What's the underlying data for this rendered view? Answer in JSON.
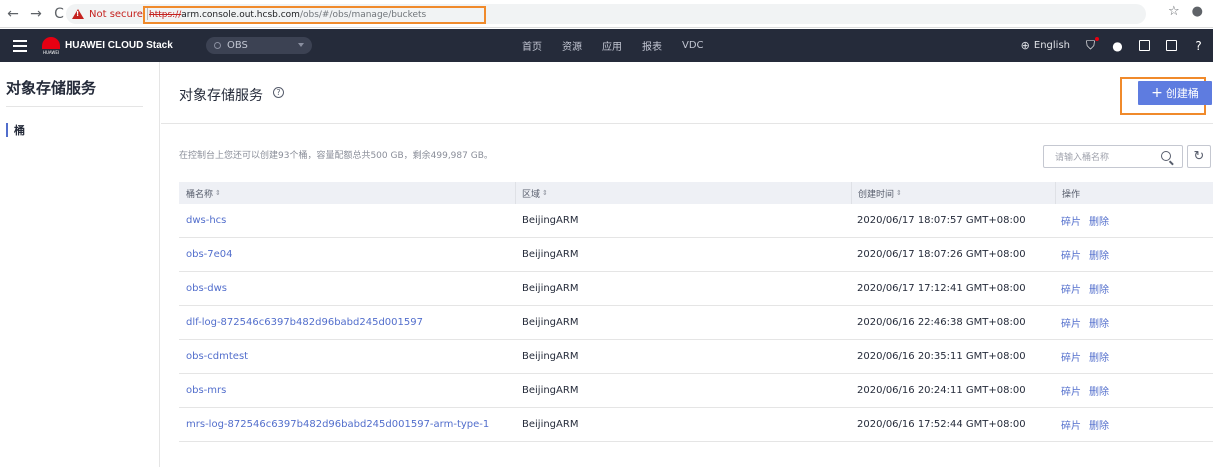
{
  "browser": {
    "not_secure": "Not secure",
    "url_scheme": "https://",
    "url_host": "arm.console.out.hcsb.com",
    "url_path": "/obs/#/obs/manage/buckets"
  },
  "header": {
    "brand": "HUAWEI CLOUD Stack",
    "logo_sub": "HUAWEI",
    "region": "OBS",
    "nav": [
      "首页",
      "资源",
      "应用",
      "报表",
      "VDC"
    ],
    "language": "English"
  },
  "sidebar": {
    "title": "对象存储服务",
    "items": [
      {
        "label": "桶"
      }
    ]
  },
  "main": {
    "title": "对象存储服务",
    "create_label": "创建桶",
    "quota_text": "在控制台上您还可以创建93个桶，容量配额总共500 GB，剩余499,987 GB。",
    "search_placeholder": "请输入桶名称"
  },
  "table": {
    "headers": [
      "桶名称",
      "区域",
      "创建时间",
      "操作"
    ],
    "rows": [
      {
        "name": "dws-hcs",
        "region": "BeijingARM",
        "created": "2020/06/17 18:07:57 GMT+08:00",
        "op1": "碎片",
        "op2": "删除"
      },
      {
        "name": "obs-7e04",
        "region": "BeijingARM",
        "created": "2020/06/17 18:07:26 GMT+08:00",
        "op1": "碎片",
        "op2": "删除"
      },
      {
        "name": "obs-dws",
        "region": "BeijingARM",
        "created": "2020/06/17 17:12:41 GMT+08:00",
        "op1": "碎片",
        "op2": "删除"
      },
      {
        "name": "dlf-log-872546c6397b482d96babd245d001597",
        "region": "BeijingARM",
        "created": "2020/06/16 22:46:38 GMT+08:00",
        "op1": "碎片",
        "op2": "删除"
      },
      {
        "name": "obs-cdmtest",
        "region": "BeijingARM",
        "created": "2020/06/16 20:35:11 GMT+08:00",
        "op1": "碎片",
        "op2": "删除"
      },
      {
        "name": "obs-mrs",
        "region": "BeijingARM",
        "created": "2020/06/16 20:24:11 GMT+08:00",
        "op1": "碎片",
        "op2": "删除"
      },
      {
        "name": "mrs-log-872546c6397b482d96babd245d001597-arm-type-1",
        "region": "BeijingARM",
        "created": "2020/06/16 17:52:44 GMT+08:00",
        "op1": "碎片",
        "op2": "删除"
      }
    ]
  },
  "colors": {
    "accent": "#5e7ce0",
    "link": "#526ecc",
    "header_bg": "#252b3a",
    "highlight": "#f08a2b"
  }
}
